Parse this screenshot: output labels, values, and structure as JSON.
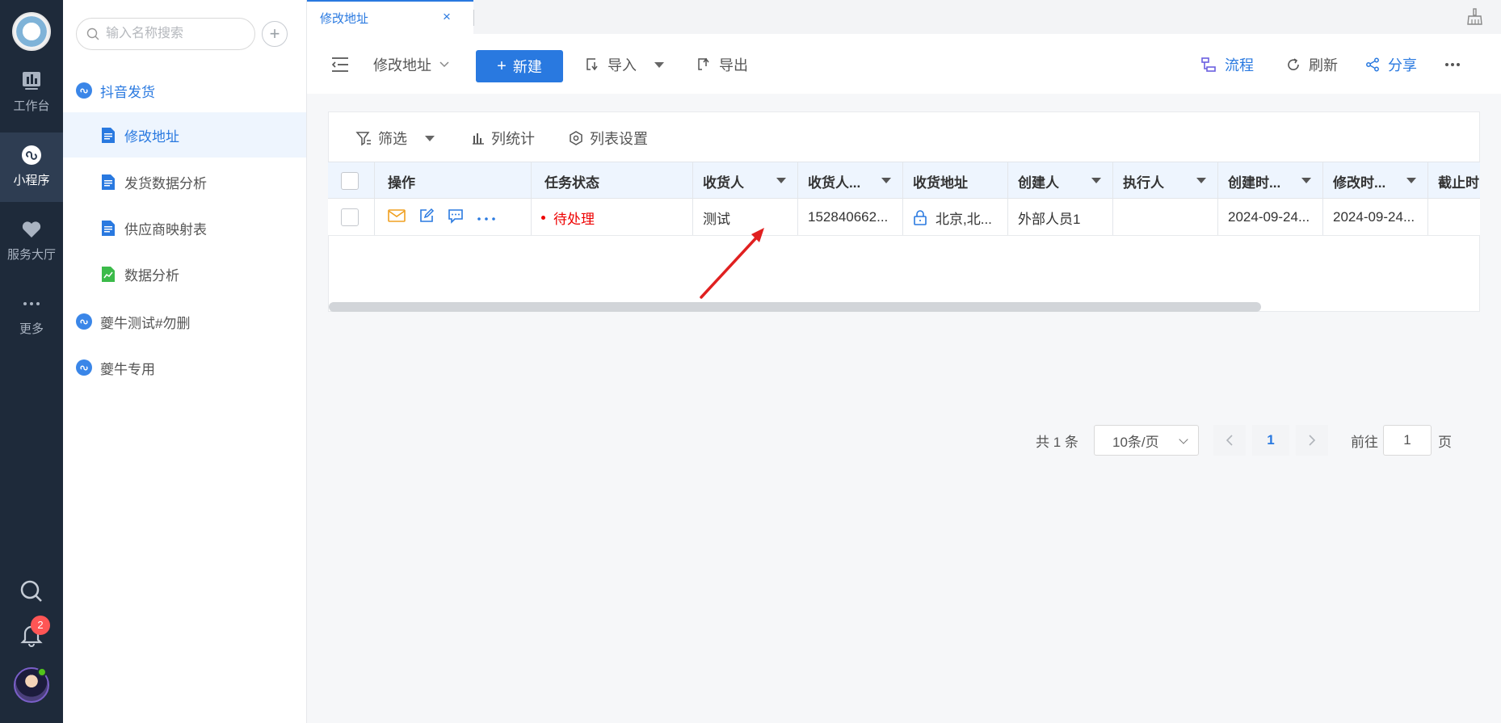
{
  "rail": {
    "items": [
      {
        "label": "工作台",
        "icon": "dashboard-icon"
      },
      {
        "label": "小程序",
        "icon": "mini-program-icon",
        "active": true
      },
      {
        "label": "服务大厅",
        "icon": "heart-icon"
      },
      {
        "label": "更多",
        "icon": "more-dots-icon"
      }
    ],
    "notification_count": "2"
  },
  "sidebar": {
    "search_placeholder": "输入名称搜索",
    "groups": [
      {
        "label": "抖音发货",
        "items": [
          "修改地址",
          "发货数据分析",
          "供应商映射表",
          "数据分析"
        ]
      },
      {
        "label": "夔牛测试#勿删"
      },
      {
        "label": "夔牛专用"
      }
    ]
  },
  "tabs": [
    {
      "label": "修改地址",
      "close": "×"
    }
  ],
  "toolbar": {
    "view_name": "修改地址",
    "new_label": "新建",
    "new_plus": "+",
    "import_label": "导入",
    "export_label": "导出",
    "flow_label": "流程",
    "refresh_label": "刷新",
    "share_label": "分享"
  },
  "filters": {
    "filter_label": "筛选",
    "stats_label": "列统计",
    "settings_label": "列表设置"
  },
  "table": {
    "columns": [
      "操作",
      "任务状态",
      "收货人",
      "收货人...",
      "收货地址",
      "创建人",
      "执行人",
      "创建时...",
      "修改时...",
      "截止时"
    ],
    "rows": [
      {
        "status": "待处理",
        "receiver": "测试",
        "receiver_phone": "152840662...",
        "address": "北京,北...",
        "creator": "外部人员1",
        "executor": "",
        "created": "2024-09-24...",
        "modified": "2024-09-24...",
        "deadline": ""
      }
    ]
  },
  "pagination": {
    "total": "共 1 条",
    "page_size": "10条/页",
    "current": "1",
    "goto_label": "前往",
    "goto_value": "1",
    "page_suffix": "页"
  },
  "colors": {
    "accent": "#2979e0",
    "status_red": "#e00000",
    "rail_bg": "#1e2a3a",
    "arrow": "#e02020"
  }
}
